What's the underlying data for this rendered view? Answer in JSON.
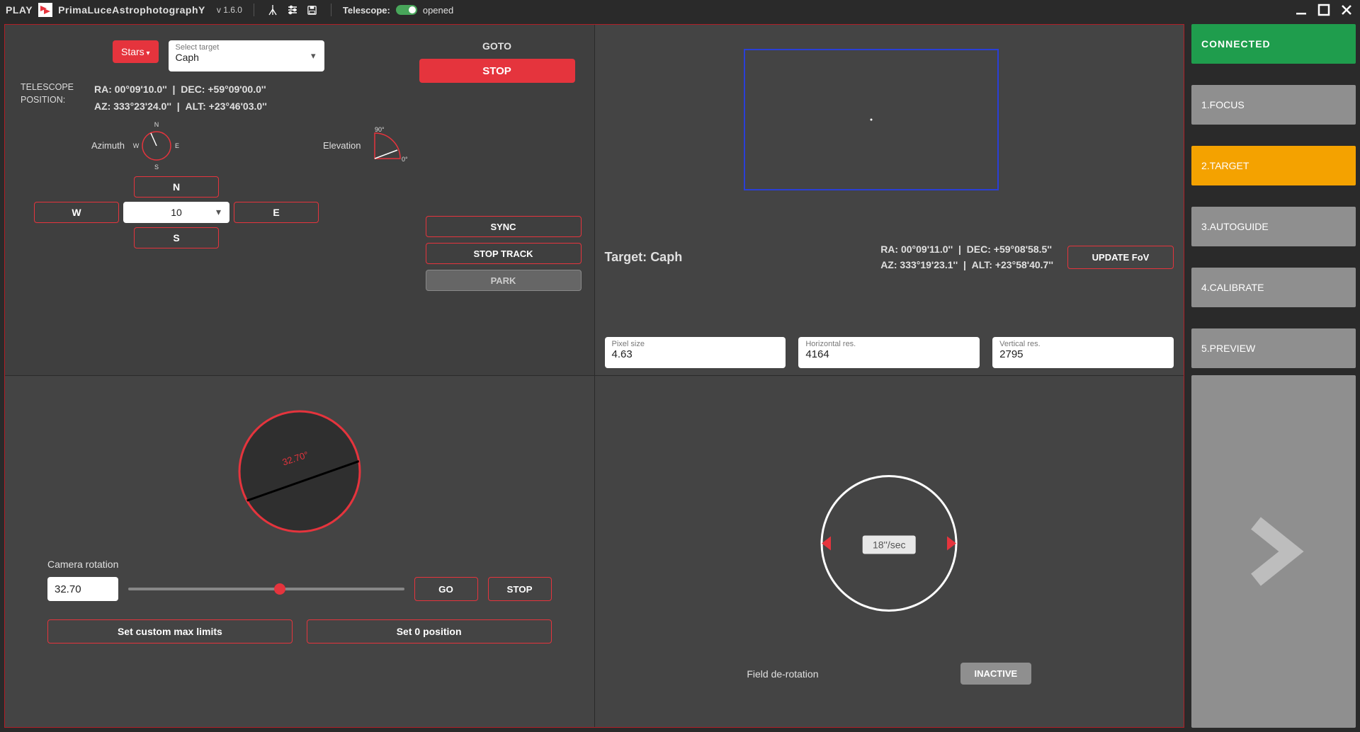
{
  "header": {
    "play": "PLAY",
    "brand": "PrimaLuceAstrophotographY",
    "version": "v 1.6.0",
    "telescope_label": "Telescope:",
    "telescope_status": "opened"
  },
  "sidebar": {
    "connected": "CONNECTED",
    "items": [
      "1.FOCUS",
      "2.TARGET",
      "3.AUTOGUIDE",
      "4.CALIBRATE",
      "5.PREVIEW"
    ]
  },
  "telescope": {
    "stars_dropdown": "Stars",
    "select_target_label": "Select target",
    "select_target_value": "Caph",
    "position_label1": "TELESCOPE",
    "position_label2": "POSITION:",
    "ra_label": "RA:",
    "ra_value": "00°09'10.0''",
    "dec_label": "DEC:",
    "dec_value": "+59°09'00.0''",
    "az_label": "AZ:",
    "az_value": "333°23'24.0''",
    "alt_label": "ALT:",
    "alt_value": "+23°46'03.0''",
    "azimuth_label": "Azimuth",
    "elevation_label": "Elevation",
    "compass": {
      "n": "N",
      "e": "E",
      "s": "S",
      "w": "W"
    },
    "elev_90": "90°",
    "elev_0": "0°",
    "goto_label": "GOTO",
    "stop_btn": "STOP",
    "dir_n": "N",
    "dir_w": "W",
    "dir_e": "E",
    "dir_s": "S",
    "step_value": "10",
    "sync_btn": "SYNC",
    "stop_track_btn": "STOP TRACK",
    "park_btn": "PARK"
  },
  "target": {
    "name_label": "Target:",
    "name_value": "Caph",
    "ra_label": "RA:",
    "ra_value": "00°09'11.0''",
    "dec_label": "DEC:",
    "dec_value": "+59°08'58.5''",
    "az_label": "AZ:",
    "az_value": "333°19'23.1''",
    "alt_label": "ALT:",
    "alt_value": "+23°58'40.7''",
    "update_fov_btn": "UPDATE FoV",
    "pixel_size_label": "Pixel size",
    "pixel_size_value": "4.63",
    "hres_label": "Horizontal res.",
    "hres_value": "4164",
    "vres_label": "Vertical res.",
    "vres_value": "2795"
  },
  "rotation": {
    "dial_value": "32.70°",
    "label": "Camera rotation",
    "input_value": "32.70",
    "slider_pct": 55,
    "go_btn": "GO",
    "stop_btn": "STOP",
    "set_limits_btn": "Set custom max limits",
    "set_zero_btn": "Set 0 position"
  },
  "derotation": {
    "rate_value": "18''/sec",
    "label": "Field de-rotation",
    "inactive_btn": "INACTIVE"
  }
}
